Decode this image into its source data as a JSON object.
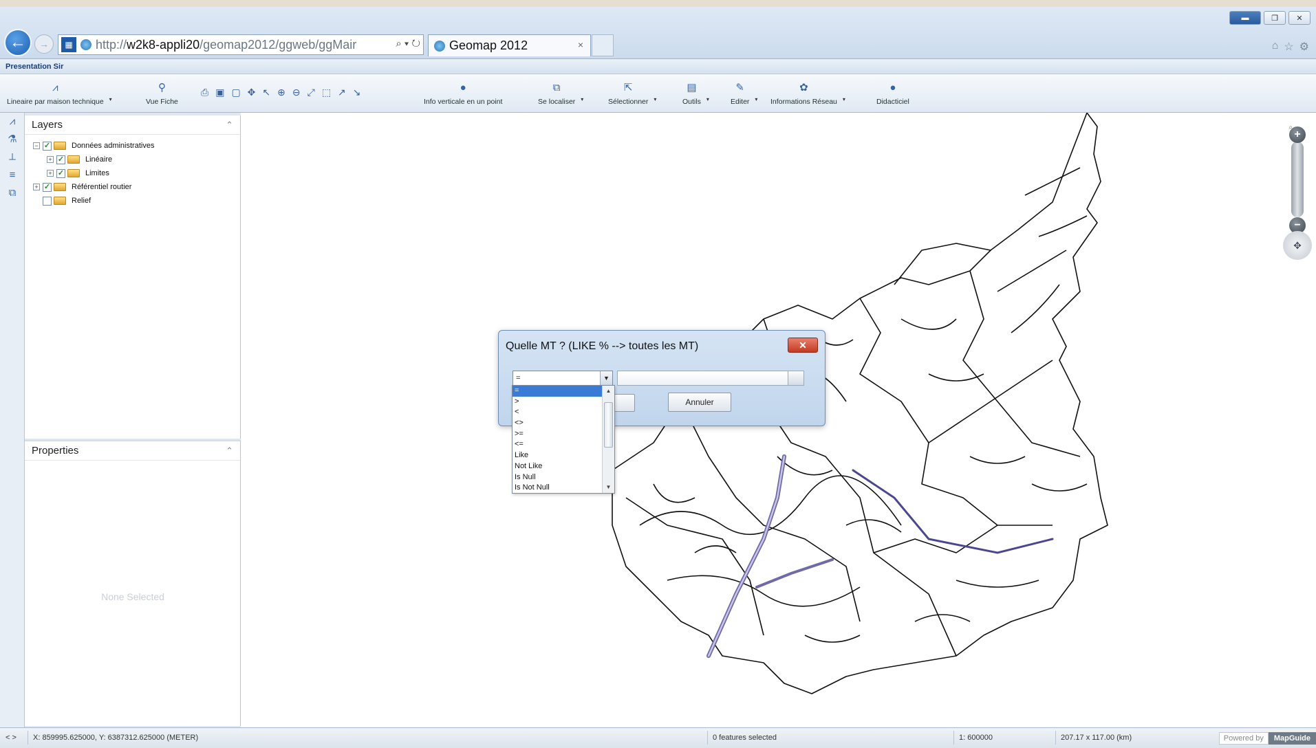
{
  "browser": {
    "url_domain": "w2k8-appli20",
    "url_rest": "/geomap2012/ggweb/ggMair",
    "url_prefix": "http://",
    "tab_title": "Geomap 2012",
    "tab_close": "×"
  },
  "app": {
    "title": "Presentation Sir"
  },
  "toolbar": {
    "items": [
      {
        "label": "Lineaire par maison technique",
        "icon": "line-chart-icon"
      },
      {
        "label": "Vue Fiche",
        "icon": "pin-icon"
      },
      {
        "label": "Info verticale en un point",
        "icon": "info-icon"
      },
      {
        "label": "Se localiser",
        "icon": "binoculars-icon"
      },
      {
        "label": "Sélectionner",
        "icon": "select-icon"
      },
      {
        "label": "Outils",
        "icon": "tools-icon"
      },
      {
        "label": "Editer",
        "icon": "pencil-icon"
      },
      {
        "label": "Informations Réseau",
        "icon": "network-icon"
      },
      {
        "label": "Didacticiel",
        "icon": "help-icon"
      }
    ]
  },
  "layers": {
    "title": "Layers",
    "items": [
      {
        "label": "Données administratives",
        "checked": true,
        "level": 0,
        "expander": "⊟"
      },
      {
        "label": "Linéaire",
        "checked": true,
        "level": 1,
        "expander": "⊞"
      },
      {
        "label": "Limites",
        "checked": true,
        "level": 1,
        "expander": "⊞"
      },
      {
        "label": "Référentiel routier",
        "checked": true,
        "level": 0,
        "expander": "⊞"
      },
      {
        "label": "Relief",
        "checked": false,
        "level": 0,
        "expander": ""
      }
    ]
  },
  "properties": {
    "title": "Properties",
    "empty_text": "None Selected"
  },
  "dialog": {
    "title": "Quelle MT ? (LIKE % --> toutes les MT)",
    "close_label": "✕",
    "selected_operator": "=",
    "cancel_label": "Annuler",
    "operators": [
      "=",
      ">",
      "<",
      "<>",
      ">=",
      "<=",
      "Like",
      "Not Like",
      "Is Null",
      "Is Not Null"
    ]
  },
  "status": {
    "coords": "X: 859995.625000, Y: 6387312.625000 (METER)",
    "selection": "0 features selected",
    "scale": "1: 600000",
    "extent": "207.17 x 117.00 (km)",
    "powered_by": "Powered by",
    "brand": "MapGuide"
  },
  "colors": {
    "accent": "#1d5fb0",
    "selected_item": "#3a7bd5",
    "close_red": "#c33a22"
  }
}
